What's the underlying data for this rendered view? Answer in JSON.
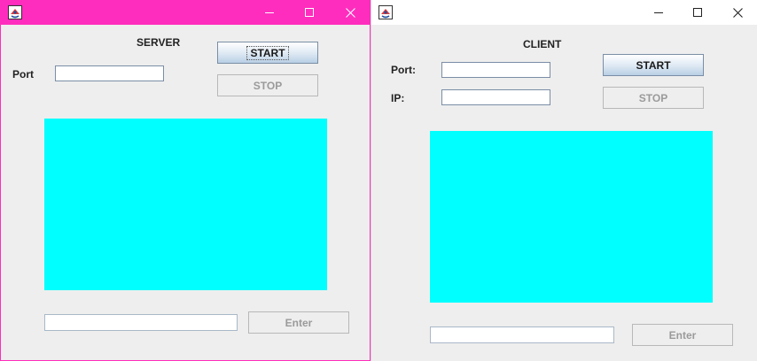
{
  "server": {
    "heading": "SERVER",
    "port_label": "Port",
    "port_value": "",
    "start_label": "START",
    "stop_label": "STOP",
    "message_value": "",
    "enter_label": "Enter",
    "titlebar_color": "#ff2dbd",
    "display_color": "#00ffff"
  },
  "client": {
    "heading": "CLIENT",
    "port_label": "Port:",
    "port_value": "",
    "ip_label": "IP:",
    "ip_value": "",
    "start_label": "START",
    "stop_label": "STOP",
    "message_value": "",
    "enter_label": "Enter",
    "titlebar_color": "#ffffff",
    "display_color": "#00ffff"
  },
  "icons": {
    "app": "java-cup-icon",
    "minimize": "minimize-icon",
    "maximize": "maximize-icon",
    "close": "close-icon"
  }
}
